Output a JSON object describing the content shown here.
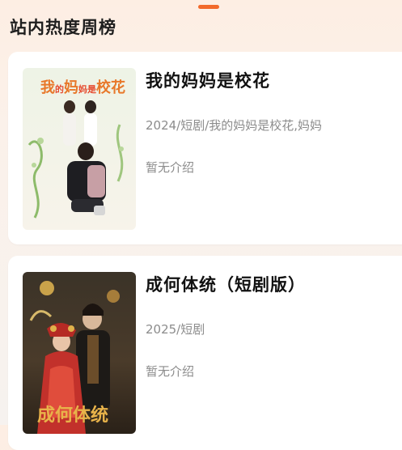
{
  "section": {
    "title": "站内热度周榜"
  },
  "items": [
    {
      "title": "我的妈妈是校花",
      "meta": "2024/短剧/我的妈妈是校花,妈妈",
      "desc": "暂无介绍",
      "poster_text": "我的妈妈是校花"
    },
    {
      "title": "成何体统（短剧版）",
      "meta": "2025/短剧",
      "desc": "暂无介绍",
      "poster_text": "成何体统"
    }
  ],
  "colors": {
    "accent": "#f26a2b"
  }
}
